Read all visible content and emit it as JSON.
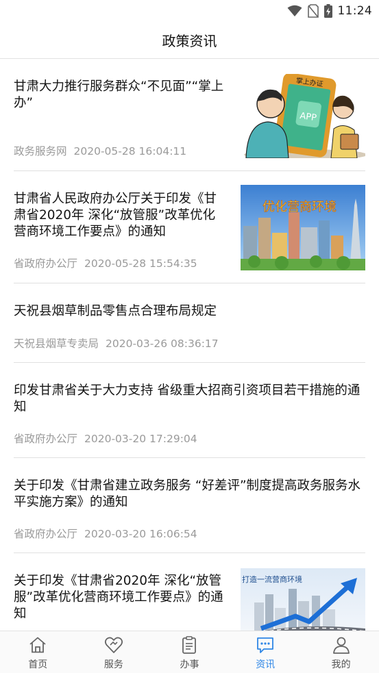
{
  "status_bar": {
    "time": "11:24",
    "icons": [
      "wifi-icon",
      "no-sim-icon",
      "battery-charging-icon"
    ]
  },
  "header": {
    "title": "政策资讯"
  },
  "news": [
    {
      "title": "甘肃大力推行服务群众“不见面”“掌上办”",
      "source": "政务服务网",
      "date": "2020-05-28 16:04:11",
      "has_image": true,
      "image_text_1": "掌上办证",
      "image_text_2": "APP"
    },
    {
      "title": "甘肃省人民政府办公厅关于印发《甘肃省2020年 深化“放管服”改革优化营商环境工作要点》的通知",
      "source": "省政府办公厅",
      "date": "2020-05-28 15:54:35",
      "has_image": true,
      "image_text_1": "优化营商环境"
    },
    {
      "title": "天祝县烟草制品零售点合理布局规定",
      "source": "天祝县烟草专卖局",
      "date": "2020-03-26 08:36:17",
      "has_image": false
    },
    {
      "title": "印发甘肃省关于大力支持 省级重大招商引资项目若干措施的通知",
      "source": "省政府办公厅",
      "date": "2020-03-20 17:29:04",
      "has_image": false
    },
    {
      "title": "关于印发《甘肃省建立政务服务 “好差评”制度提高政务服务水平实施方案》的通知",
      "source": "省政府办公厅",
      "date": "2020-03-20 16:06:54",
      "has_image": false
    },
    {
      "title": "关于印发《甘肃省2020年 深化“放管服”改革优化营商环境工作要点》的通知",
      "source": "",
      "date": "",
      "has_image": true,
      "image_text_1": "打造一流营商环境"
    }
  ],
  "tabs": [
    {
      "label": "首页",
      "icon": "home-icon",
      "active": false
    },
    {
      "label": "服务",
      "icon": "heart-icon",
      "active": false
    },
    {
      "label": "办事",
      "icon": "clipboard-icon",
      "active": false
    },
    {
      "label": "资讯",
      "icon": "chat-icon",
      "active": true
    },
    {
      "label": "我的",
      "icon": "user-icon",
      "active": false
    }
  ],
  "colors": {
    "accent": "#2e86e6",
    "meta_text": "#9a9a9a",
    "divider": "#e0e0e0"
  }
}
